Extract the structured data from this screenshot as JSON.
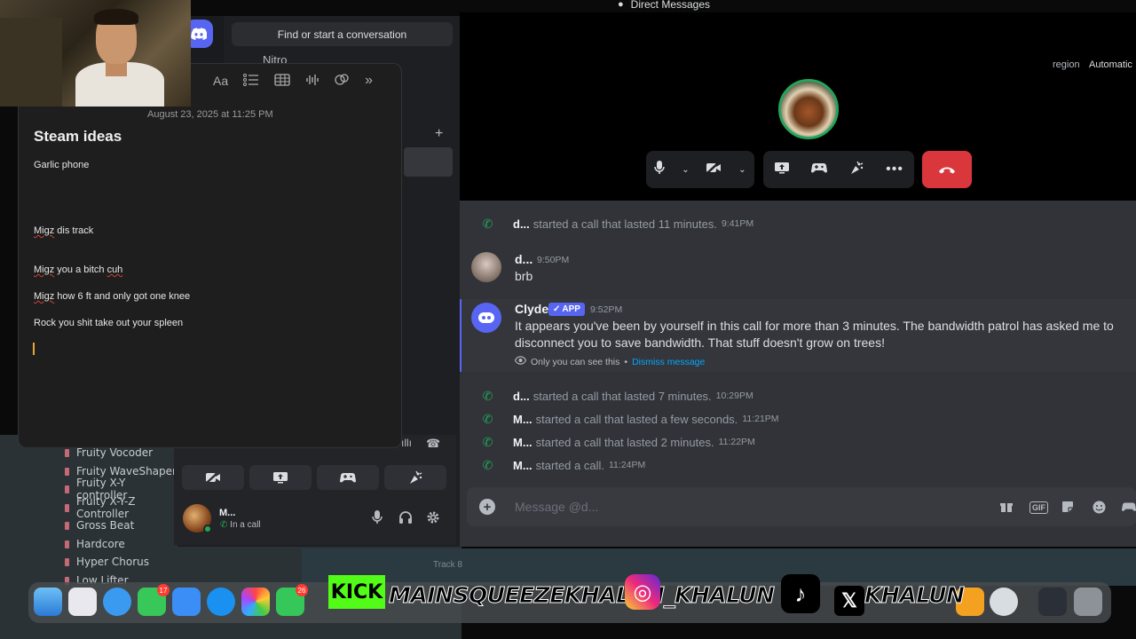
{
  "daw": {
    "plugins": [
      "Fruity Vocoder",
      "Fruity WaveShaper",
      "Fruity X-Y controller",
      "Fruity X-Y-Z Controller",
      "Gross Beat",
      "Hardcore",
      "Hyper Chorus",
      "Low Lifter"
    ],
    "track_label": "Track 8"
  },
  "discord": {
    "window_title": "Direct Messages",
    "search_placeholder": "Find or start a conversation",
    "nitro_label": "Nitro",
    "region_label": "region",
    "region_value": "Automatic",
    "user": {
      "name": "M...",
      "status": "In a call"
    },
    "messages": {
      "call1": {
        "who": "d...",
        "text": "started a call that lasted 11 minutes.",
        "time": "9:41PM"
      },
      "d_msg": {
        "who": "d...",
        "time": "9:50PM",
        "text": "brb"
      },
      "clyde": {
        "name": "Clyde",
        "badge": "APP",
        "time": "9:52PM",
        "text": "It appears you've been by yourself in this call for more than 3 minutes. The bandwidth patrol has asked me to disconnect you to save bandwidth. That stuff doesn't grow on trees!",
        "note": "Only you can see this",
        "separator": "•",
        "dismiss": "Dismiss message"
      },
      "call2": {
        "who": "d...",
        "text": "started a call that lasted 7 minutes.",
        "time": "10:29PM"
      },
      "call3": {
        "who": "M...",
        "text": "started a call that lasted a few seconds.",
        "time": "11:21PM"
      },
      "call4": {
        "who": "M...",
        "text": "started a call that lasted 2 minutes.",
        "time": "11:22PM"
      },
      "call5": {
        "who": "M...",
        "text": "started a call.",
        "time": "11:24PM"
      }
    },
    "composer_placeholder": "Message @d...",
    "composer_gif": "GIF"
  },
  "notes": {
    "toolbar_font": "Aa",
    "date": "August 23, 2025 at 11:25 PM",
    "title": "Steam ideas",
    "lines": {
      "l1": "Garlic phone",
      "l2a": "Migz",
      "l2b": " dis track",
      "l3a": "Migz",
      "l3b": " you a bitch ",
      "l3c": "cuh",
      "l4a": "Migz",
      "l4b": " how 6 ft and only got one knee",
      "l5": "Rock you shit take out your spleen"
    }
  },
  "dock": {
    "messages_badge": "17",
    "facetime_badge": "26",
    "overlay_kick": "KICK",
    "overlay_kick_name": "MAINSQUEEZEKHALUN",
    "overlay_ig_name": "_KHALUN",
    "overlay_x_name": "KHALUN"
  },
  "colors": {
    "blurple": "#5865f2",
    "green": "#23a55a",
    "red": "#da373c",
    "link": "#00a8fc",
    "kick_green": "#53fc18"
  }
}
